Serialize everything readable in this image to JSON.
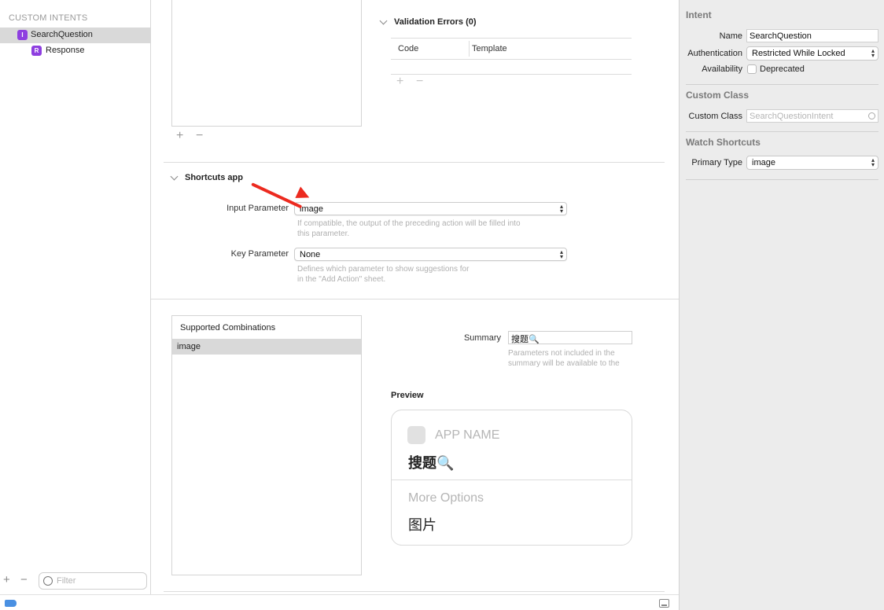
{
  "sidebar": {
    "header": "CUSTOM INTENTS",
    "items": [
      {
        "badge": "I",
        "label": "SearchQuestion"
      },
      {
        "badge": "R",
        "label": "Response"
      }
    ],
    "add_symbol": "+",
    "remove_symbol": "−",
    "filter_placeholder": "Filter"
  },
  "validation": {
    "title": "Validation Errors (0)",
    "columns": [
      "Code",
      "Template"
    ]
  },
  "shortcuts": {
    "title": "Shortcuts app",
    "input_parameter": {
      "label": "Input Parameter",
      "value": "image",
      "hint_line1": "If compatible, the output of the preceding action will be filled into",
      "hint_line2": "this parameter."
    },
    "key_parameter": {
      "label": "Key Parameter",
      "value": "None",
      "hint_line1": "Defines which parameter to show suggestions for",
      "hint_line2": "in the \"Add Action\" sheet."
    }
  },
  "combinations": {
    "header": "Supported Combinations",
    "items": [
      "image"
    ]
  },
  "summary": {
    "label": "Summary",
    "value": "搜题🔍",
    "hint_line1": "Parameters not included in the",
    "hint_line2": "summary will be available to the"
  },
  "preview": {
    "title": "Preview",
    "app_name": "APP NAME",
    "card_title": "搜题🔍",
    "more_options": "More Options",
    "option_value": "图片"
  },
  "inspector": {
    "intent": {
      "title": "Intent",
      "name_label": "Name",
      "name_value": "SearchQuestion",
      "auth_label": "Authentication",
      "auth_value": "Restricted While Locked",
      "avail_label": "Availability",
      "deprecated_label": "Deprecated"
    },
    "custom_class": {
      "title": "Custom Class",
      "label": "Custom Class",
      "placeholder": "SearchQuestionIntent"
    },
    "watch": {
      "title": "Watch Shortcuts",
      "label": "Primary Type",
      "value": "image"
    }
  },
  "colors": {
    "accent_badge": "#8e3fe0",
    "annotation_arrow": "#ec2a1f",
    "status_tag": "#4a90e2"
  },
  "icons": {
    "popup_arrows": "⌃⌄",
    "search_emoji": "🔍"
  }
}
